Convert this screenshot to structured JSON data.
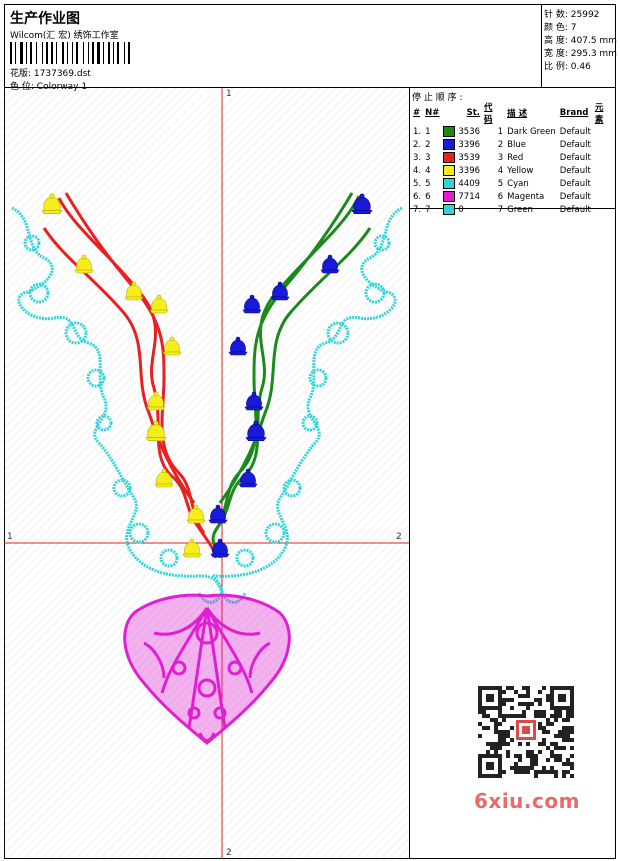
{
  "header": {
    "title": "生产作业图",
    "company": "Wilcom(汇 宏) 绣饰工作室",
    "file_label": "花版:",
    "file_name": "1737369.dst",
    "colorway_label": "色 位:",
    "colorway_name": "Colorway 1"
  },
  "stats": [
    {
      "label": "针 数:",
      "value": "25992"
    },
    {
      "label": "颜 色:",
      "value": "7"
    },
    {
      "label": "高 度:",
      "value": "407.5 mm"
    },
    {
      "label": "宽 度:",
      "value": "295.3 mm"
    },
    {
      "label": "比 例:",
      "value": "0.46"
    }
  ],
  "legend": {
    "title": "停 止 顺 序 :",
    "headers": [
      "#",
      "N#",
      "St.",
      "代 码",
      "描 述",
      "Brand",
      "元 素"
    ],
    "rows": [
      {
        "num": "1.",
        "n": "1",
        "color": "#1a8a1a",
        "st": "3536",
        "code": "1",
        "desc": "Dark Green",
        "brand": "Default"
      },
      {
        "num": "2.",
        "n": "2",
        "color": "#1a1adb",
        "st": "3396",
        "code": "2",
        "desc": "Blue",
        "brand": "Default"
      },
      {
        "num": "3.",
        "n": "3",
        "color": "#e82020",
        "st": "3539",
        "code": "3",
        "desc": "Red",
        "brand": "Default"
      },
      {
        "num": "4.",
        "n": "4",
        "color": "#f5ee1a",
        "st": "3396",
        "code": "4",
        "desc": "Yellow",
        "brand": "Default"
      },
      {
        "num": "5.",
        "n": "5",
        "color": "#2ed6dc",
        "st": "4409",
        "code": "5",
        "desc": "Cyan",
        "brand": "Default"
      },
      {
        "num": "6.",
        "n": "6",
        "color": "#e020d0",
        "st": "7714",
        "code": "6",
        "desc": "Magenta",
        "brand": "Default"
      },
      {
        "num": "7.",
        "n": "7",
        "color": "#2ed6dc",
        "st": "0",
        "code": "7",
        "desc": "Green",
        "brand": "Default"
      }
    ]
  },
  "axis_labels": {
    "top": "1",
    "bottom": "2",
    "left": "1",
    "right": "2"
  },
  "watermark": "6xiu.com"
}
